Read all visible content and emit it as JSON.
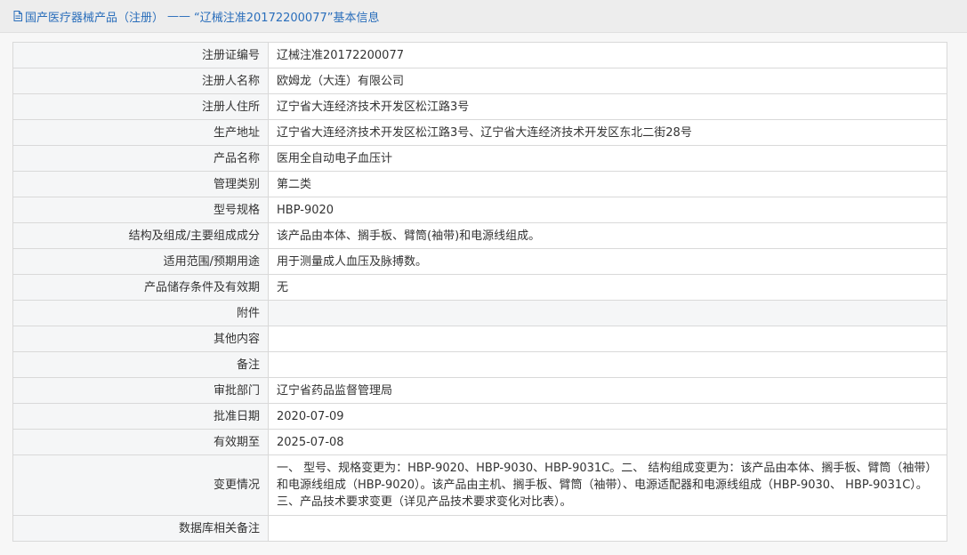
{
  "header": {
    "category": "国产医疗器械产品（注册）",
    "separator": "——",
    "title": "“辽械注准20172200077”基本信息",
    "icon": "document-icon",
    "accent": "#2a6ebb"
  },
  "rows": [
    {
      "label": "注册证编号",
      "value": "辽械注准20172200077"
    },
    {
      "label": "注册人名称",
      "value": "欧姆龙（大连）有限公司"
    },
    {
      "label": "注册人住所",
      "value": "辽宁省大连经济技术开发区松江路3号"
    },
    {
      "label": "生产地址",
      "value": "辽宁省大连经济技术开发区松江路3号、辽宁省大连经济技术开发区东北二街28号"
    },
    {
      "label": "产品名称",
      "value": "医用全自动电子血压计"
    },
    {
      "label": "管理类别",
      "value": "第二类"
    },
    {
      "label": "型号规格",
      "value": "HBP-9020"
    },
    {
      "label": "结构及组成/主要组成成分",
      "value": "该产品由本体、搁手板、臂筒(袖带)和电源线组成。"
    },
    {
      "label": "适用范围/预期用途",
      "value": "用于测量成人血压及脉搏数。"
    },
    {
      "label": "产品储存条件及有效期",
      "value": "无"
    },
    {
      "label": "附件",
      "value": ""
    },
    {
      "label": "其他内容",
      "value": ""
    },
    {
      "label": "备注",
      "value": ""
    },
    {
      "label": "审批部门",
      "value": "辽宁省药品监督管理局"
    },
    {
      "label": "批准日期",
      "value": "2020-07-09"
    },
    {
      "label": "有效期至",
      "value": "2025-07-08"
    },
    {
      "label": "变更情况",
      "value": "一、 型号、规格变更为：HBP-9020、HBP-9030、HBP-9031C。二、 结构组成变更为：该产品由本体、搁手板、臂筒（袖带）和电源线组成（HBP-9020）。该产品由主机、搁手板、臂筒（袖带）、电源适配器和电源线组成（HBP-9030、 HBP-9031C）。三、产品技术要求变更（详见产品技术要求变化对比表）。"
    },
    {
      "label": "数据库相关备注",
      "value": ""
    }
  ]
}
